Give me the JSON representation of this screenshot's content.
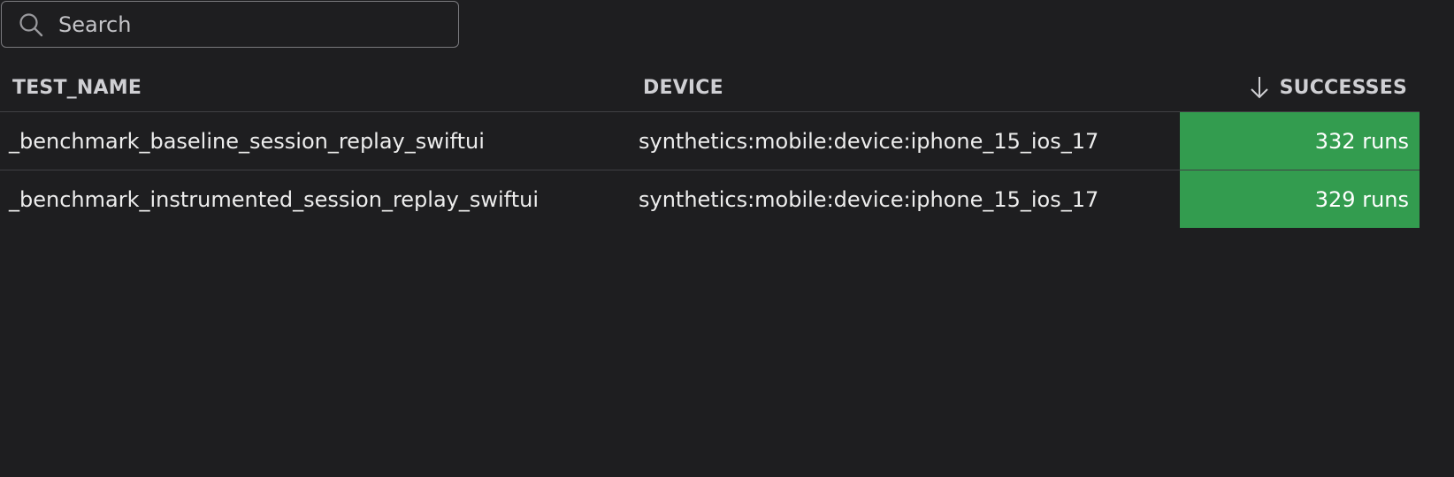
{
  "search": {
    "placeholder": "Search",
    "value": "",
    "icon": "search-icon"
  },
  "table": {
    "columns": [
      {
        "key": "test_name",
        "label": "TEST_NAME"
      },
      {
        "key": "device",
        "label": "DEVICE"
      },
      {
        "key": "successes",
        "label": "SUCCESSES",
        "sort": "descending",
        "sort_icon": "arrow-down-icon"
      }
    ],
    "rows": [
      {
        "test_name": "_benchmark_baseline_session_replay_swiftui",
        "device": "synthetics:mobile:device:iphone_15_ios_17",
        "successes": "332 runs"
      },
      {
        "test_name": "_benchmark_instrumented_session_replay_swiftui",
        "device": "synthetics:mobile:device:iphone_15_ios_17",
        "successes": "329 runs"
      }
    ]
  },
  "colors": {
    "background": "#1e1e20",
    "success_cell": "#339c4f",
    "divider": "#404044",
    "header_text": "#cfcfd3"
  }
}
